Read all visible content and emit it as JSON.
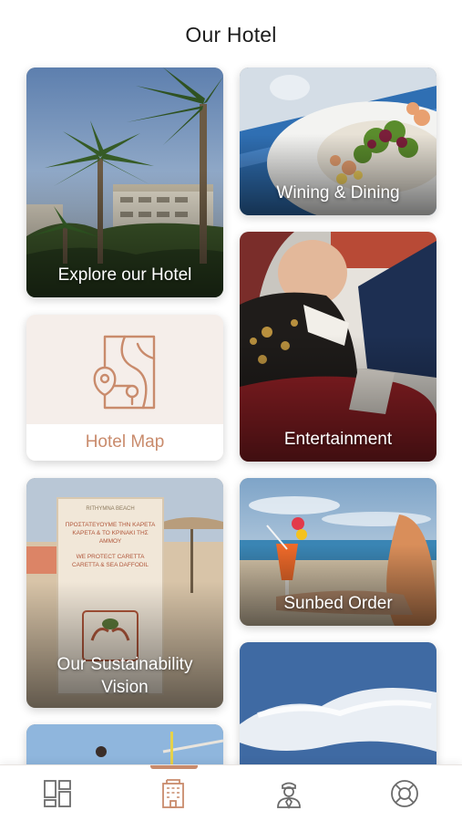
{
  "header": {
    "title": "Our Hotel"
  },
  "cards": {
    "explore": "Explore our Hotel",
    "dining": "Wining & Dining",
    "map": "Hotel Map",
    "entertainment": "Entertainment",
    "sustainability_line1": "Our Sustainability",
    "sustainability_line2": "Vision",
    "sunbed": "Sunbed Order"
  },
  "sign": {
    "hotel": "RITHYMNA BEACH",
    "greek": "ΠΡΟΣΤΑΤΕΥΟΥΜΕ ΤΗΝ ΚΑΡΕΤΑ ΚΑΡΕΤΑ & ΤΟ ΚΡΙΝΑΚΙ ΤΗΣ ΑΜΜΟΥ",
    "english": "WE PROTECT CARETTA CARETTA & SEA DAFFODIL"
  },
  "tabs": [
    {
      "icon": "dashboard-icon"
    },
    {
      "icon": "hotel-building-icon",
      "active": true
    },
    {
      "icon": "concierge-icon"
    },
    {
      "icon": "lifebuoy-icon"
    }
  ],
  "colors": {
    "accent": "#c98b6c",
    "text": "#1c1c1c",
    "map_bg": "#f6efec"
  }
}
